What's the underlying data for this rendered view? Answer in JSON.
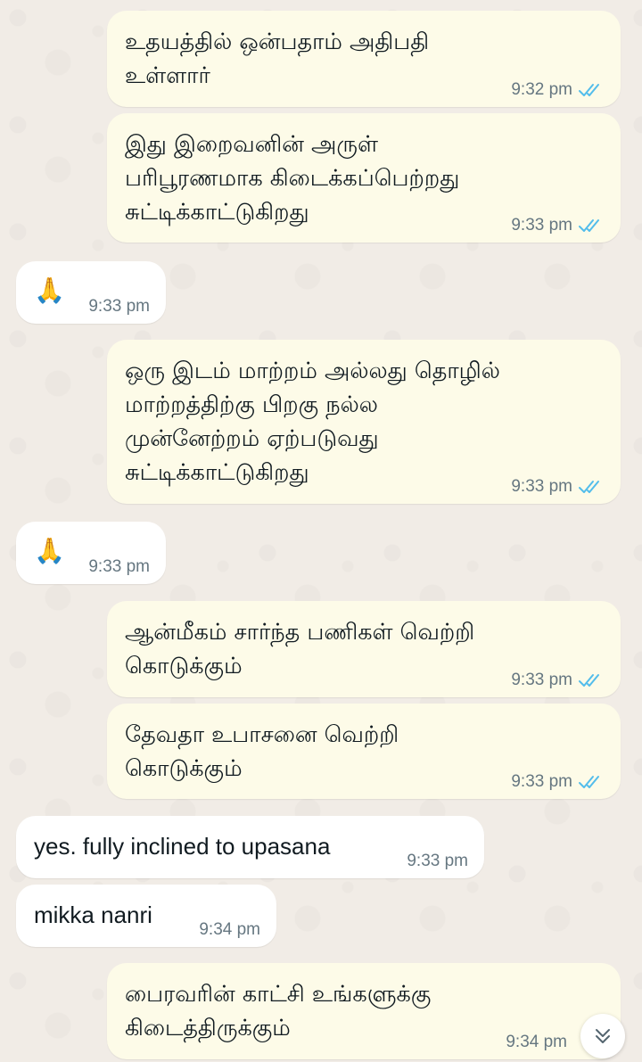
{
  "messages": [
    {
      "direction": "outgoing",
      "text": "உதயத்தில் ஒன்பதாம் அதிபதி\nஉள்ளார்",
      "time": "9:32 pm",
      "status": "read"
    },
    {
      "direction": "outgoing",
      "text": "இது இறைவனின் அருள்\nபரிபூரணமாக கிடைக்கப்பெற்றது\nசுட்டிக்காட்டுகிறது",
      "time": "9:33 pm",
      "status": "read"
    },
    {
      "direction": "incoming",
      "text": "🙏",
      "time": "9:33 pm"
    },
    {
      "direction": "outgoing",
      "text": "ஒரு இடம் மாற்றம் அல்லது தொழில்\nமாற்றத்திற்கு பிறகு நல்ல\nமுன்னேற்றம் ஏற்படுவது\nசுட்டிக்காட்டுகிறது",
      "time": "9:33 pm",
      "status": "read"
    },
    {
      "direction": "incoming",
      "text": "🙏",
      "time": "9:33 pm"
    },
    {
      "direction": "outgoing",
      "text": "ஆன்மீகம் சார்ந்த பணிகள் வெற்றி\nகொடுக்கும்",
      "time": "9:33 pm",
      "status": "read"
    },
    {
      "direction": "outgoing",
      "text": "தேவதா உபாசனை வெற்றி\nகொடுக்கும்",
      "time": "9:33 pm",
      "status": "read"
    },
    {
      "direction": "incoming",
      "text": "yes. fully inclined to upasana",
      "time": "9:33 pm"
    },
    {
      "direction": "incoming",
      "text": "mikka nanri",
      "time": "9:34 pm"
    },
    {
      "direction": "outgoing",
      "text": " பைரவரின் காட்சி உங்களுக்கு\nகிடைத்திருக்கும்",
      "time": "9:34 pm",
      "status": "read"
    }
  ],
  "colors": {
    "outgoing_bubble": "#fdfbe8",
    "incoming_bubble": "#ffffff",
    "read_tick": "#53bdeb",
    "timestamp": "#667781",
    "background": "#efeae2"
  },
  "icons": {
    "read_receipt": "double-check-icon",
    "scroll_down": "double-chevron-down-icon"
  }
}
